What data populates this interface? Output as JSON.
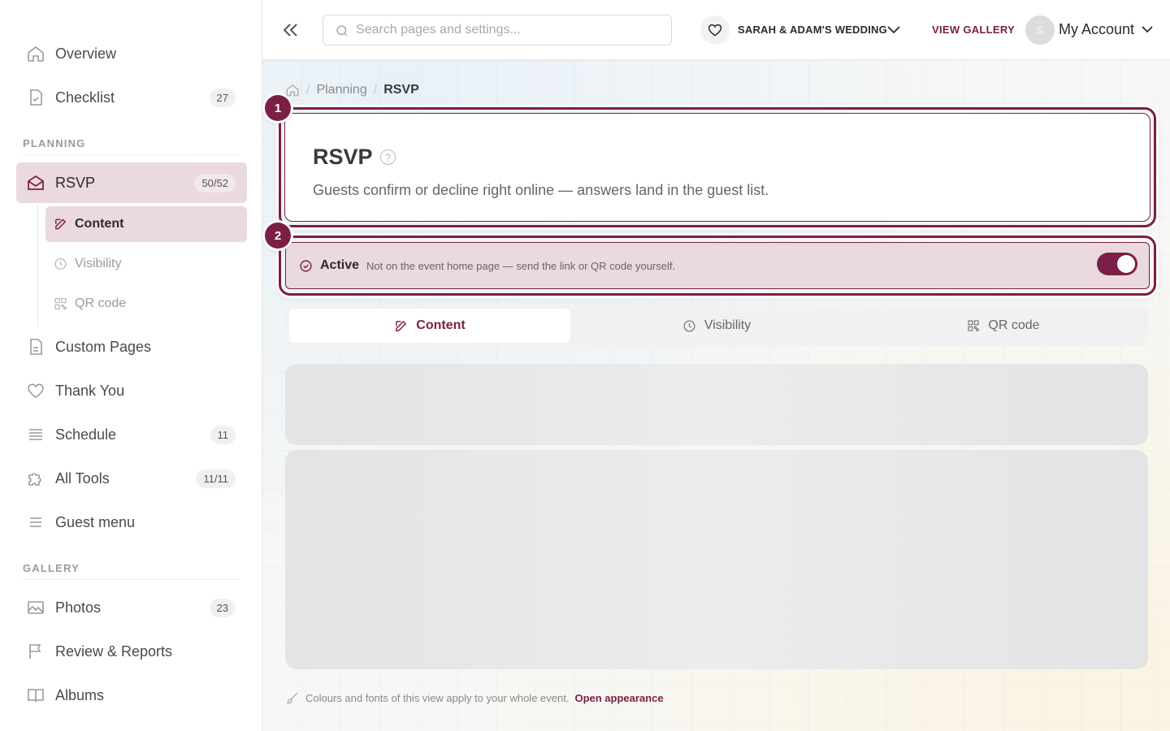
{
  "sidebar": {
    "items": [
      {
        "label": "Overview"
      },
      {
        "label": "Checklist",
        "count": "27"
      },
      {
        "label": "RSVP",
        "count": "50/52"
      },
      {
        "label": "Custom Pages"
      },
      {
        "label": "Thank You"
      },
      {
        "label": "Schedule",
        "count": "11"
      },
      {
        "label": "All Tools",
        "count": "11/11"
      },
      {
        "label": "Guest menu"
      },
      {
        "label": "Photos",
        "count": "23"
      },
      {
        "label": "Review & Reports"
      },
      {
        "label": "Albums"
      }
    ],
    "sections": {
      "planning": "PLANNING",
      "gallery": "GALLERY"
    },
    "subitems": [
      {
        "label": "Content"
      },
      {
        "label": "Visibility"
      },
      {
        "label": "QR code"
      }
    ]
  },
  "topbar": {
    "search_placeholder": "Search pages and settings...",
    "event_name": "SARAH & ADAM'S WEDDING",
    "view_gallery": "VIEW GALLERY",
    "avatar_initial": "S",
    "account": "My Account"
  },
  "breadcrumb": {
    "parent": "Planning",
    "current": "RSVP",
    "separator": "/"
  },
  "page": {
    "title": "RSVP",
    "help": "?",
    "description": "Guests confirm or decline right online — answers land in the guest list."
  },
  "status": {
    "label": "Active",
    "text": "Not on the event home page — send the link or QR code yourself.",
    "enabled": true
  },
  "highlights": {
    "first": "1",
    "second": "2"
  },
  "tabs": [
    {
      "label": "Content",
      "icon": "edit-icon"
    },
    {
      "label": "Visibility",
      "icon": "clock-icon"
    },
    {
      "label": "QR code",
      "icon": "qr-icon"
    }
  ],
  "footer": {
    "note": "Colours and fonts of this view apply to your whole event.",
    "link": "Open appearance"
  },
  "colors": {
    "accent": "#7a1f45",
    "active_bg": "#ead9de"
  }
}
